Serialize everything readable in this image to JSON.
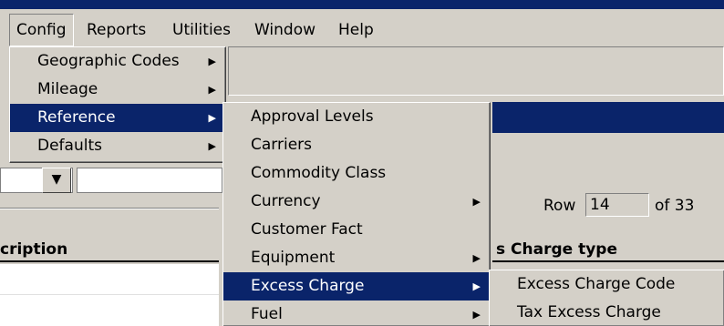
{
  "menubar": {
    "items": [
      "Config",
      "Reports",
      "Utilities",
      "Window",
      "Help"
    ],
    "active": "Config"
  },
  "config_menu": {
    "items": [
      {
        "label": "Geographic Codes",
        "submenu": true
      },
      {
        "label": "Mileage",
        "submenu": true
      },
      {
        "label": "Reference",
        "submenu": true,
        "selected": true
      },
      {
        "label": "Defaults",
        "submenu": true
      }
    ]
  },
  "reference_menu": {
    "items": [
      {
        "label": "Approval Levels",
        "submenu": false
      },
      {
        "label": "Carriers",
        "submenu": false
      },
      {
        "label": "Commodity Class",
        "submenu": false
      },
      {
        "label": "Currency",
        "submenu": true
      },
      {
        "label": "Customer Fact",
        "submenu": false
      },
      {
        "label": "Equipment",
        "submenu": true
      },
      {
        "label": "Excess Charge",
        "submenu": true,
        "selected": true
      },
      {
        "label": "Fuel",
        "submenu": true
      }
    ]
  },
  "excess_charge_menu": {
    "items": [
      {
        "label": "Excess Charge Code"
      },
      {
        "label": "Tax Excess Charge"
      }
    ]
  },
  "background": {
    "row_label": "Row",
    "row_value": "14",
    "of_label": "of 33",
    "column_header_left": "cription",
    "column_header_right": "s Charge type",
    "dropdown_arrow": "▼"
  },
  "colors": {
    "menu_bg": "#d4d0c8",
    "selection": "#0a246a",
    "selection_text": "#ffffff"
  },
  "icons": {
    "submenu_arrow": "▶",
    "dropdown_arrow": "chevron-down-icon"
  }
}
